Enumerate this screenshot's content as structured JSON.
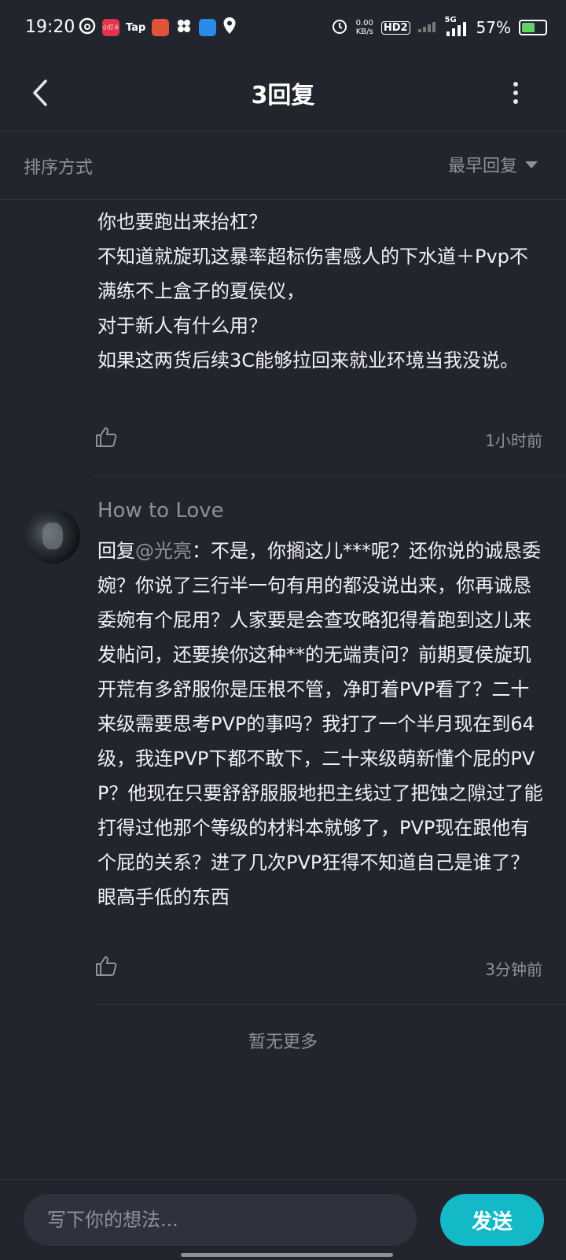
{
  "status_bar": {
    "time": "19:20",
    "app_icons": [
      "netease-music-icon",
      "xiaohongshu-icon",
      "taptap-icon",
      "game-icon",
      "flower-icon",
      "chat-icon",
      "location-icon"
    ],
    "tiny_label_1": "小打卡",
    "tiny_label_2": "Tap",
    "net_speed": "0.00\nKB/s",
    "hd_label": "HD2",
    "signal_label": "5G",
    "battery": "57%",
    "battery_level": 0.57
  },
  "header": {
    "title": "3回复",
    "back_icon": "chevron-left-icon",
    "more_icon": "more-vertical-icon"
  },
  "sort": {
    "label": "排序方式",
    "selected": "最早回复"
  },
  "comments": [
    {
      "text": "你也要跑出来抬杠？\n不知道就旋玑这暴率超标伤害感人的下水道＋Pvp不满练不上盒子的夏侯仪，\n对于新人有什么用？\n如果这两货后续3C能够拉回来就业环境当我没说。",
      "time": "1小时前"
    },
    {
      "username": "How to Love",
      "reply_prefix": "回复",
      "mention": "@光亮",
      "text": "：不是，你搁这儿***呢？还你说的诚恳委婉？你说了三行半一句有用的都没说出来，你再诚恳委婉有个屁用？人家要是会查攻略犯得着跑到这儿来发帖问，还要挨你这种**的无端责问？前期夏侯旋玑开荒有多舒服你是压根不管，净盯着PVP看了？二十来级需要思考PVP的事吗？我打了一个半月现在到64级，我连PVP下都不敢下，二十来级萌新懂个屁的PVP？他现在只要舒舒服服地把主线过了把蚀之隙过了能打得过他那个等级的材料本就够了，PVP现在跟他有个屁的关系？进了几次PVP狂得不知道自己是谁了？眼高手低的东西",
      "time": "3分钟前"
    }
  ],
  "no_more": "暂无更多",
  "input": {
    "placeholder": "写下你的想法..."
  },
  "send_label": "发送",
  "colors": {
    "background": "#23252e",
    "accent": "#14b9c8",
    "muted_text": "#8e909a"
  }
}
